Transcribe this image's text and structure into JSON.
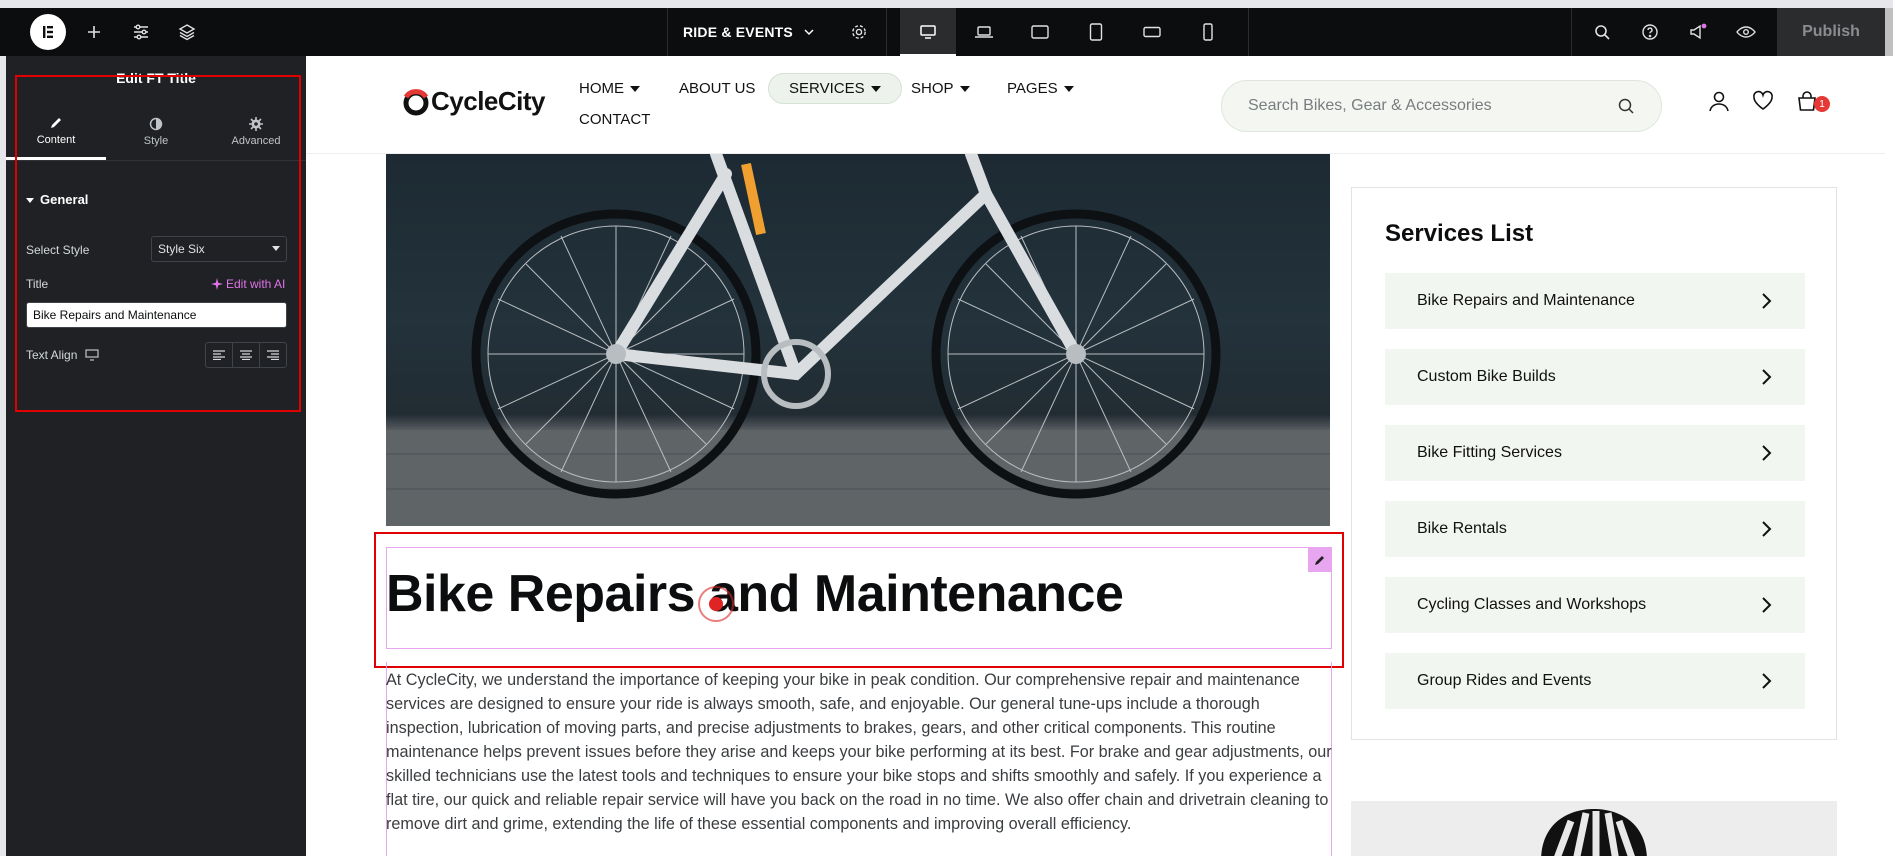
{
  "editor": {
    "page_name": "RIDE & EVENTS",
    "publish_label": "Publish",
    "panel_title": "Edit FT Title",
    "tabs": [
      {
        "label": "Content",
        "icon": "pencil-icon"
      },
      {
        "label": "Style",
        "icon": "half-circle-icon"
      },
      {
        "label": "Advanced",
        "icon": "gear-icon"
      }
    ],
    "section_label": "General",
    "select_style_label": "Select Style",
    "select_style_value": "Style Six",
    "title_label": "Title",
    "edit_with_ai_label": "Edit with AI",
    "title_value": "Bike Repairs and Maintenance",
    "text_align_label": "Text Align",
    "collapse_arrow": "‹"
  },
  "site": {
    "logo": "CycleCity",
    "nav": {
      "home": "HOME",
      "about": "ABOUT US",
      "services": "SERVICES",
      "shop": "SHOP",
      "pages": "PAGES",
      "contact": "CONTACT"
    },
    "search_placeholder": "Search Bikes, Gear & Accessories",
    "cart_count": "1"
  },
  "content": {
    "heading": "Bike Repairs and Maintenance",
    "body": "At CycleCity, we understand the importance of keeping your bike in peak condition. Our comprehensive repair and maintenance services are designed to ensure your ride is always smooth, safe, and enjoyable. Our general tune-ups include a thorough inspection, lubrication of moving parts, and precise adjustments to brakes, gears, and other critical components. This routine maintenance helps prevent issues before they arise and keeps your bike performing at its best. For brake and gear adjustments, our skilled technicians use the latest tools and techniques to ensure your bike stops and shifts smoothly and safely. If you experience a flat tire, our quick and reliable repair service will have you back on the road in no time. We also offer chain and drivetrain cleaning to remove dirt and grime, extending the life of these essential components and improving overall efficiency."
  },
  "sidebar": {
    "title": "Services List",
    "items": [
      "Bike Repairs and Maintenance",
      "Custom Bike Builds",
      "Bike Fitting Services",
      "Bike Rentals",
      "Cycling Classes and Workshops",
      "Group Rides and Events"
    ]
  },
  "colors": {
    "editor_dark": "#0c0d0e",
    "panel": "#1f2124",
    "accent_pink": "#e073ea",
    "highlight_red": "#e00000",
    "service_bg": "#f2f6f0",
    "cart_badge": "#e53935"
  }
}
